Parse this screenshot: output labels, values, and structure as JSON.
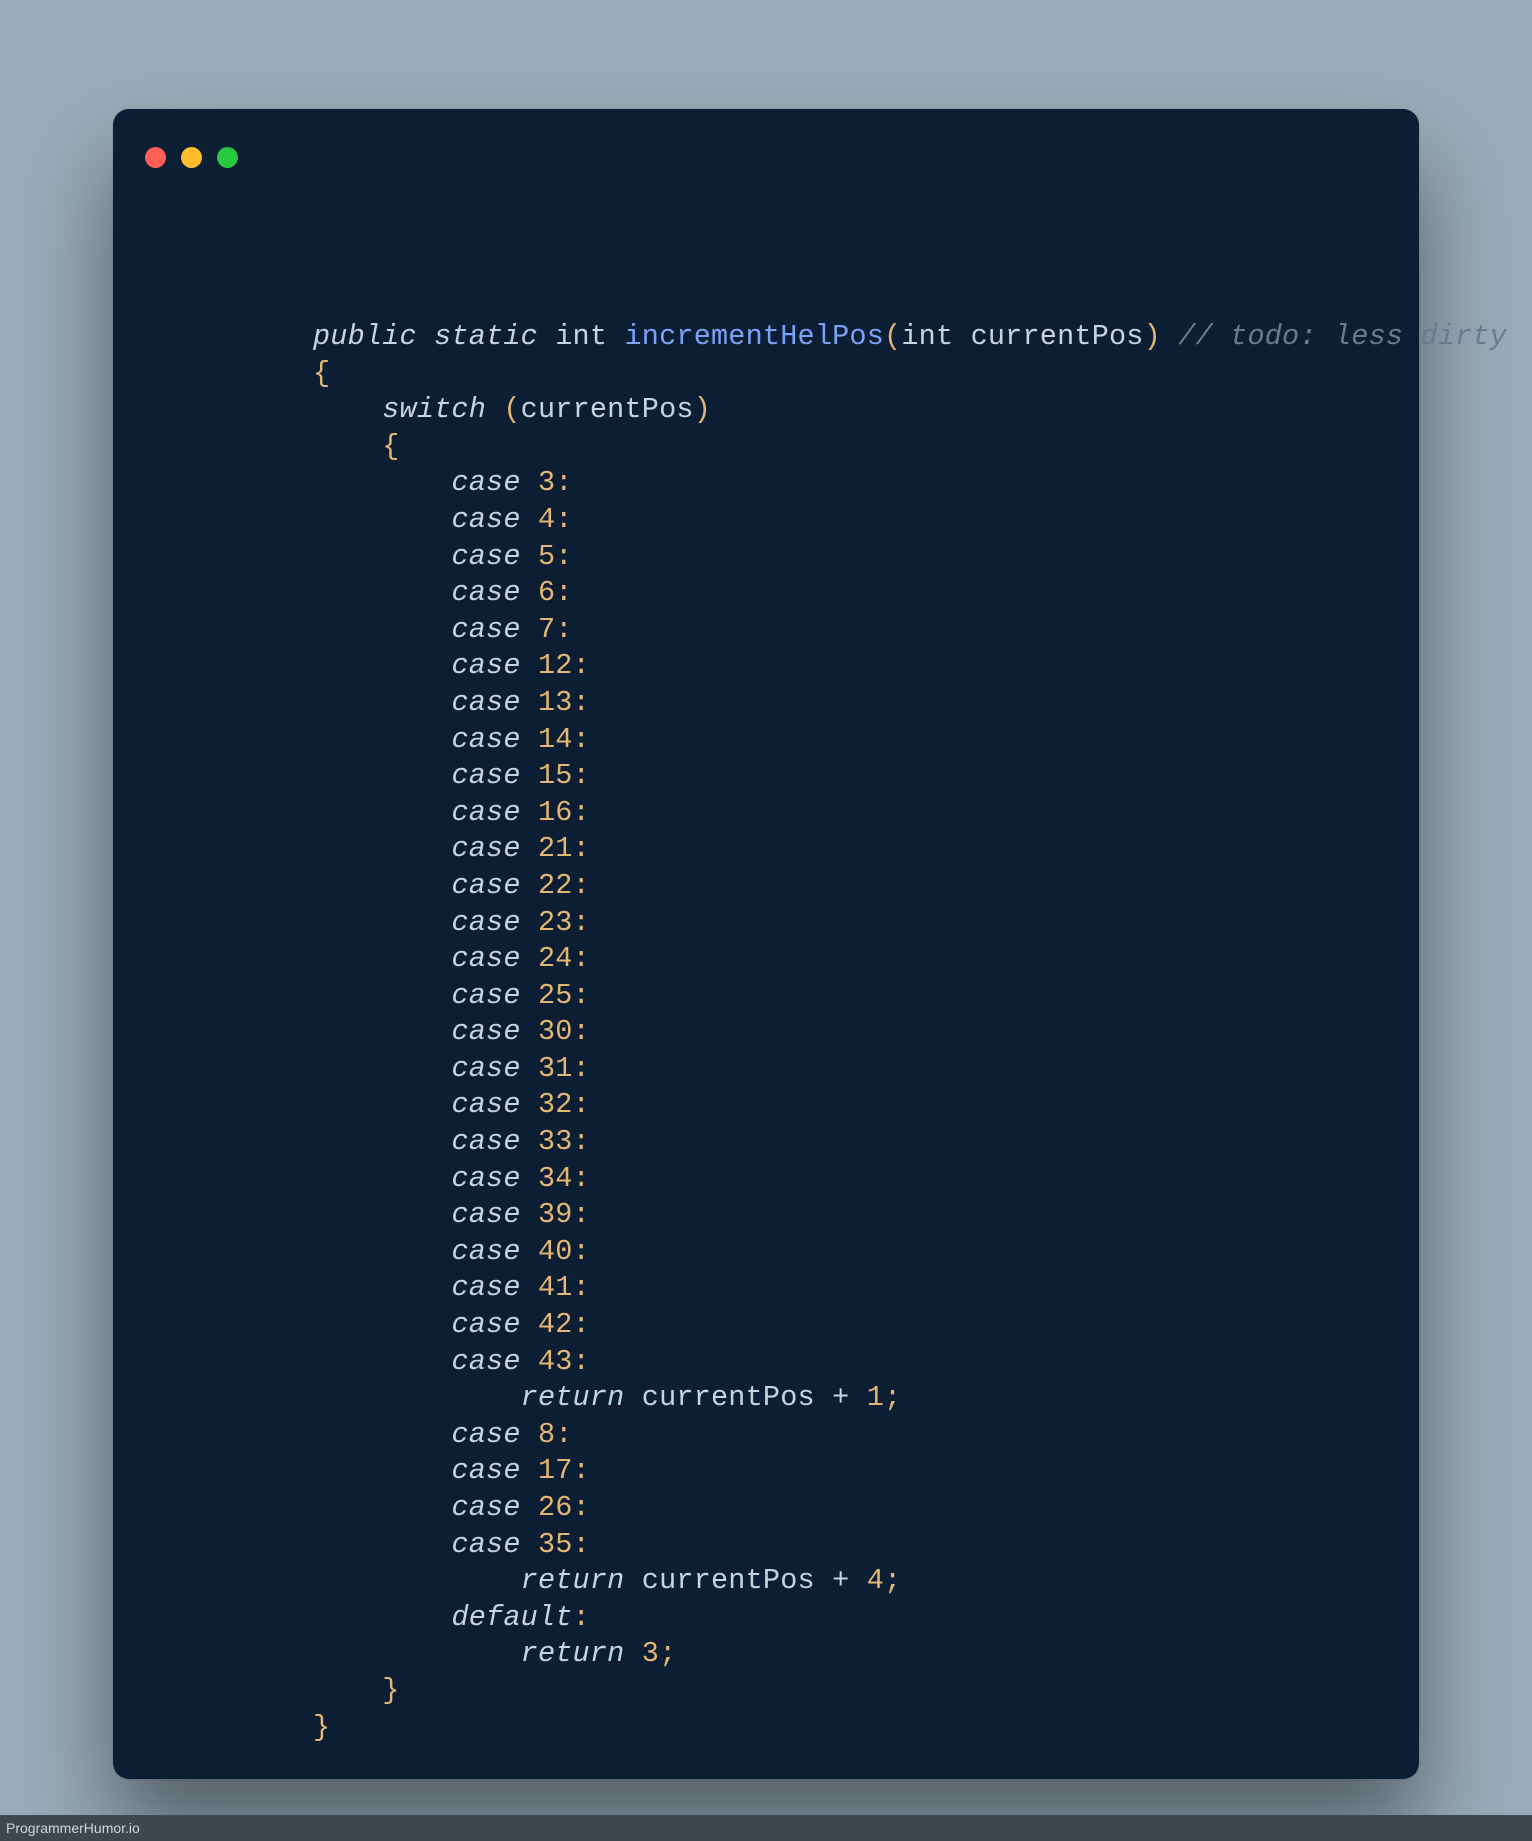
{
  "footer": {
    "text": "ProgrammerHumor.io"
  },
  "colors": {
    "bg_page": "#9aacb9",
    "bg_editor": "#0c1e33",
    "red": "#ff5f56",
    "yellow": "#ffbd2e",
    "green": "#27c93f"
  },
  "code": {
    "sig": {
      "mods": "public static",
      "type": "int",
      "name": "incrementHelPos",
      "params_open": "(",
      "param_type": "int",
      "param_name": "currentPos",
      "params_close": ")",
      "comment": "// todo: less dirty"
    },
    "open_fn": "{",
    "switch_kw": "switch",
    "switch_open": " (",
    "switch_var": "currentPos",
    "switch_close": ")",
    "open_sw": "{",
    "group1": {
      "cases": [
        "3",
        "4",
        "5",
        "6",
        "7",
        "12",
        "13",
        "14",
        "15",
        "16",
        "21",
        "22",
        "23",
        "24",
        "25",
        "30",
        "31",
        "32",
        "33",
        "34",
        "39",
        "40",
        "41",
        "42",
        "43"
      ],
      "ret_kw": "return",
      "ret_expr_var": "currentPos",
      "ret_expr_op": " + ",
      "ret_expr_n": "1",
      "ret_end": ";"
    },
    "group2": {
      "cases": [
        "8",
        "17",
        "26",
        "35"
      ],
      "ret_kw": "return",
      "ret_expr_var": "currentPos",
      "ret_expr_op": " + ",
      "ret_expr_n": "4",
      "ret_end": ";"
    },
    "default": {
      "kw": "default",
      "colon": ":",
      "ret_kw": "return",
      "ret_n": "3",
      "ret_end": ";"
    },
    "close_sw": "}",
    "close_fn": "}",
    "case_kw": "case",
    "colon": ":"
  }
}
